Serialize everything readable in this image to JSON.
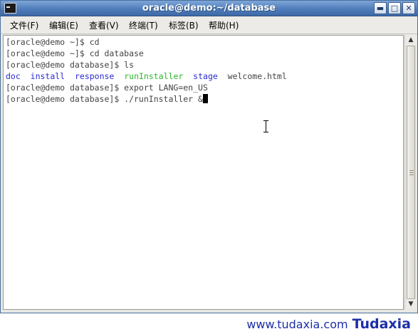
{
  "window": {
    "title": "oracle@demo:~/database",
    "icon": "terminal-icon",
    "controls": [
      "minimize-icon",
      "maximize-icon",
      "close-icon"
    ]
  },
  "menubar": {
    "items": [
      {
        "label": "文件(F)"
      },
      {
        "label": "编辑(E)"
      },
      {
        "label": "查看(V)"
      },
      {
        "label": "终端(T)"
      },
      {
        "label": "标签(B)"
      },
      {
        "label": "帮助(H)"
      }
    ]
  },
  "terminal": {
    "lines": [
      {
        "text": "[oracle@demo ~]$ cd"
      },
      {
        "text": "[oracle@demo ~]$ cd database"
      },
      {
        "text": "[oracle@demo database]$ ls"
      },
      {
        "listing": [
          {
            "name": "doc",
            "kind": "directory"
          },
          {
            "name": "install",
            "kind": "directory"
          },
          {
            "name": "response",
            "kind": "directory"
          },
          {
            "name": "runInstaller",
            "kind": "executable"
          },
          {
            "name": "stage",
            "kind": "directory"
          },
          {
            "name": "welcome.html",
            "kind": "file"
          }
        ]
      },
      {
        "text": "[oracle@demo database]$ export LANG=en_US"
      },
      {
        "text": "[oracle@demo database]$ ./runInstaller &"
      }
    ],
    "colors": {
      "directory": "#2a2ad4",
      "executable": "#2db52d",
      "file": "#444444",
      "text": "#444444"
    }
  },
  "watermark": {
    "url": "www.tudaxia.com",
    "brand": "Tudaxia"
  }
}
